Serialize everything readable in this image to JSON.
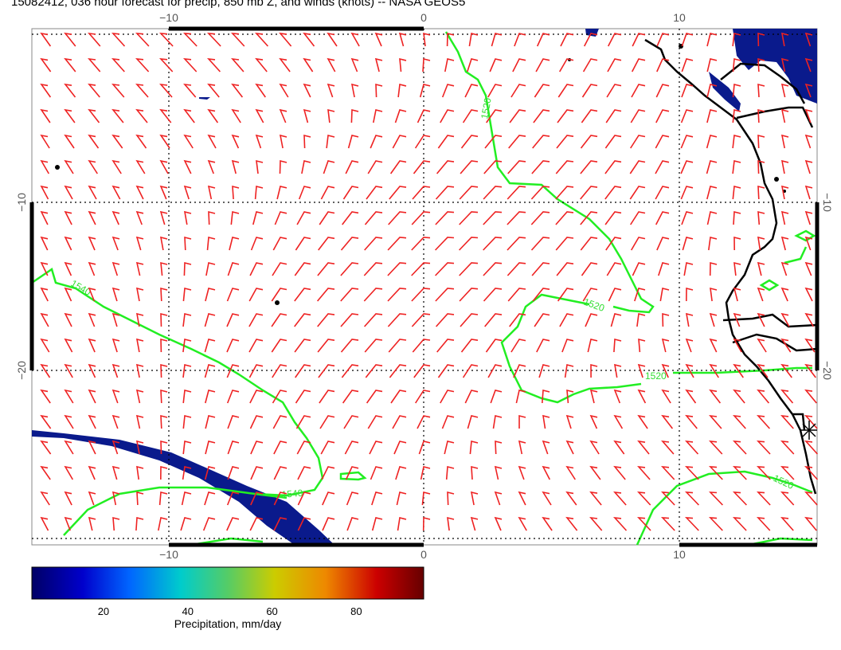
{
  "title": "15082412, 036 hour forecast for precip, 850 mb Z, and winds (knots) -- NASA GEOS5",
  "axes": {
    "lon_ticks": [
      "−10",
      "0",
      "10"
    ],
    "lat_ticks": [
      "−10",
      "−20"
    ]
  },
  "contours": {
    "labels": [
      "1540",
      "1520",
      "1520",
      "1520",
      "1540",
      "1520",
      "1520"
    ],
    "line_color": "#22ee22"
  },
  "colorbar": {
    "label": "Precipitation, mm/day",
    "ticks": [
      "20",
      "40",
      "60",
      "80"
    ],
    "tick_values": [
      20,
      40,
      60,
      80
    ],
    "range": [
      3,
      96
    ],
    "colors": [
      "#000066",
      "#0000cc",
      "#0066ff",
      "#00cccc",
      "#55cc66",
      "#cccc00",
      "#ee8800",
      "#cc0000",
      "#660000"
    ]
  },
  "colors": {
    "barb": "#ee2222",
    "precip": "#0a1a8c",
    "coast": "#000000"
  }
}
